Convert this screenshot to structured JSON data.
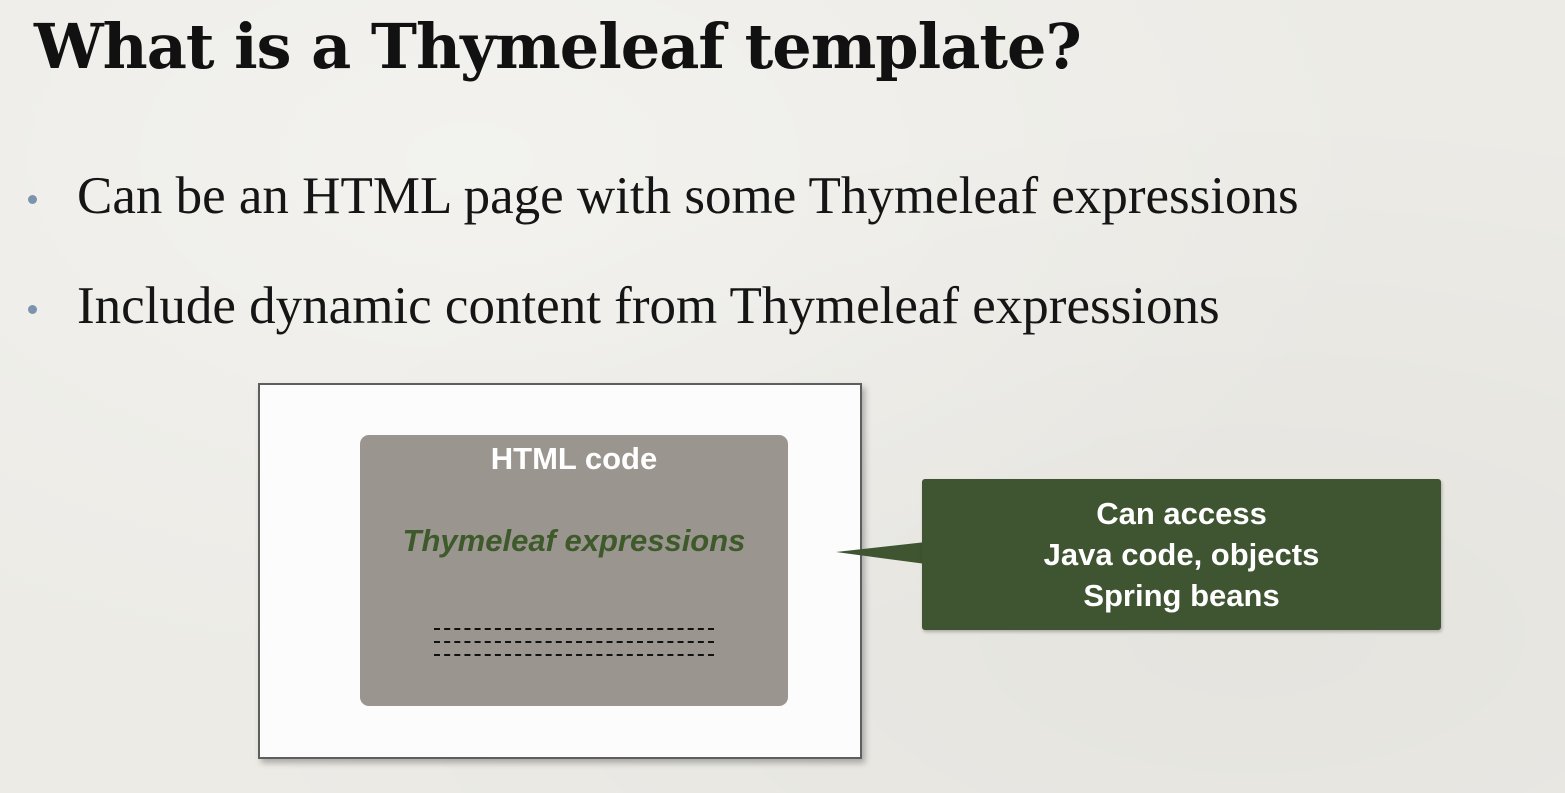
{
  "slide": {
    "title": "What is a Thymeleaf template?",
    "bullets": [
      "Can be an HTML page with some Thymeleaf expressions",
      "Include dynamic content from Thymeleaf expressions"
    ]
  },
  "diagram": {
    "code_box": {
      "heading": "HTML code",
      "expression": "Thymeleaf expressions"
    },
    "callout": {
      "lines": [
        "Can access",
        "Java code, objects",
        "Spring beans"
      ]
    }
  },
  "colors": {
    "background": "#ecebe6",
    "bullet_dot": "#7b93ad",
    "code_box_fill": "#9a958f",
    "expression_text": "#3e5a2b",
    "callout_fill": "#3f5431"
  }
}
